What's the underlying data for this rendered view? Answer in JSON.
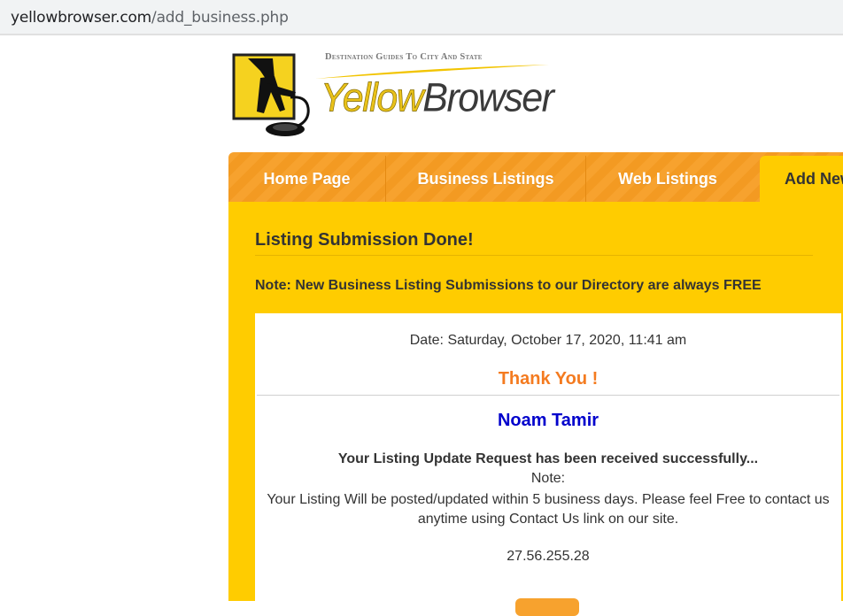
{
  "browser": {
    "url_domain": "yellowbrowser.com",
    "url_path": "/add_business.php"
  },
  "logo": {
    "tagline": "Destination Guides To City And State",
    "brand_yellow": "Yellow",
    "brand_dark": "Browser"
  },
  "nav": {
    "items": [
      {
        "label": "Home Page"
      },
      {
        "label": "Business Listings"
      },
      {
        "label": "Web Listings"
      }
    ],
    "active_label": "Add New"
  },
  "main": {
    "heading": "Listing Submission Done!",
    "note": "Note: New Business Listing Submissions to our Directory are always FREE",
    "card": {
      "date": "Date: Saturday, October 17, 2020, 11:41 am",
      "thanks": "Thank You !",
      "name": "Noam Tamir",
      "received": "Your Listing Update Request has been received successfully...",
      "note_label": "Note:",
      "body": "Your Listing Will be posted/updated within 5 business days. Please feel Free to contact us anytime using Contact Us link on our site.",
      "ip": "27.56.255.28"
    }
  },
  "colors": {
    "panel": "#ffcc00",
    "nav": "#f7a22e",
    "thanks": "#f47b20",
    "name": "#0000cc"
  }
}
